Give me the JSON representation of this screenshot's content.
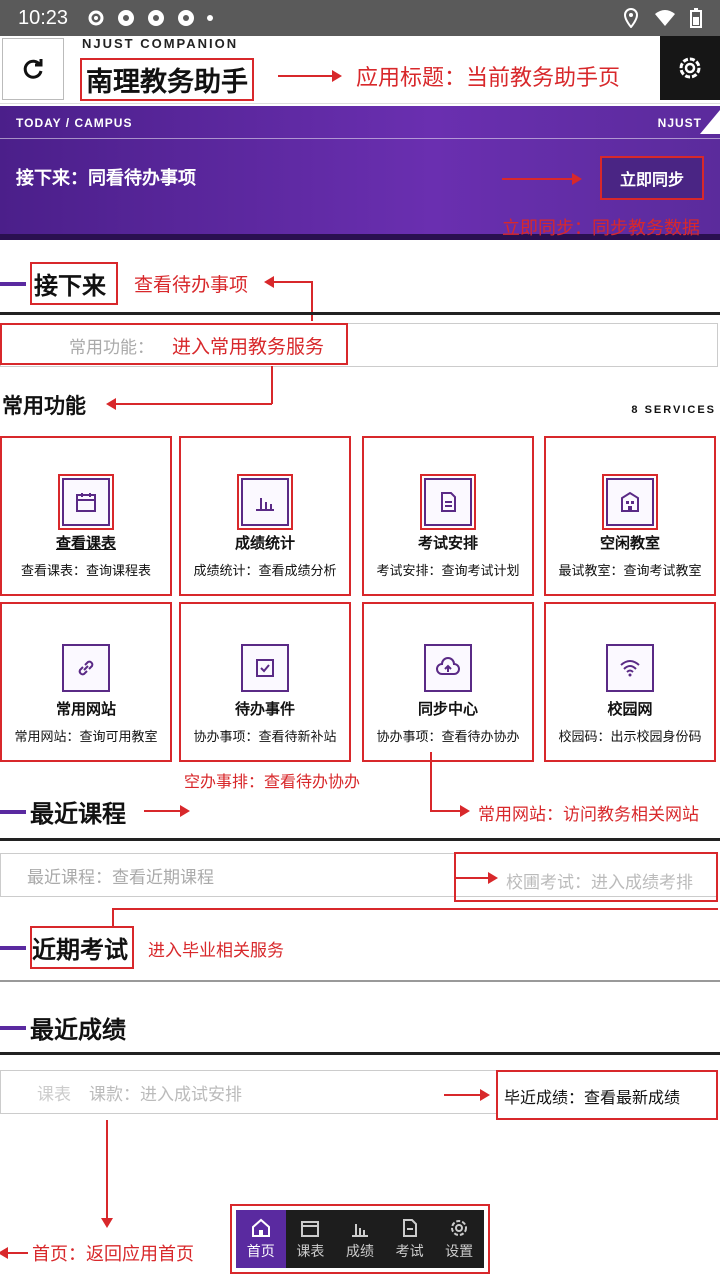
{
  "status": {
    "time": "10:23"
  },
  "header": {
    "subtitle": "NJUST COMPANION",
    "title": "南理教务助手"
  },
  "banner": {
    "top_left": "TODAY / CAMPUS",
    "top_right": "NJUST",
    "main_text": "接下来：同看待办事项",
    "sync_label": "立即同步"
  },
  "sections": {
    "next": "接下来",
    "services": "常用功能",
    "services_count": "8 SERVICES",
    "recent_courses": "最近课程",
    "upcoming_exams": "近期考试",
    "recent_grades": "最近成绩"
  },
  "faint_rows": {
    "services": "常用功能：",
    "courses": "最近课程：查看近期课程",
    "grades_a": "课表",
    "grades_b": "课款：进入成试安排"
  },
  "services": [
    {
      "name": "查看课表",
      "desc": "查看课表：查询课程表",
      "icon": "calendar-icon"
    },
    {
      "name": "成绩统计",
      "desc": "成绩统计：查看成绩分析",
      "icon": "bar-chart-icon"
    },
    {
      "name": "考试安排",
      "desc": "考试安排：查询考试计划",
      "icon": "document-icon"
    },
    {
      "name": "空闲教室",
      "desc": "最试教室：查询考试教室",
      "icon": "building-icon"
    },
    {
      "name": "常用网站",
      "desc": "常用网站：查询可用教室",
      "icon": "link-icon"
    },
    {
      "name": "待办事件",
      "desc": "协办事项：查看待新补站",
      "icon": "checkbox-icon"
    },
    {
      "name": "同步中心",
      "desc": "协办事项：查看待办协办",
      "icon": "cloud-upload-icon"
    },
    {
      "name": "校园网",
      "desc": "校园码：出示校园身份码",
      "icon": "wifi-icon"
    }
  ],
  "annotations": {
    "title": "应用标题：当前教务助手页",
    "sync": "立即同步：同步教务数据",
    "next": "查看待办事项",
    "services_row": "进入常用教务服务",
    "todo": "空办事排：查看待办协办",
    "websites": "常用网站：访问教务相关网站",
    "exams_box": "校圃考试：进入成绩考排",
    "graduation": "进入毕业相关服务",
    "grades": "毕近成绩：查看最新成绩",
    "home": "首页：返回应用首页"
  },
  "nav": [
    {
      "label": "首页",
      "icon": "home-icon",
      "active": true
    },
    {
      "label": "课表",
      "icon": "calendar-icon",
      "active": false
    },
    {
      "label": "成绩",
      "icon": "bar-chart-icon",
      "active": false
    },
    {
      "label": "考试",
      "icon": "document-icon",
      "active": false
    },
    {
      "label": "设置",
      "icon": "gear-icon",
      "active": false
    }
  ],
  "colors": {
    "accent": "#5a2aa0",
    "annotation": "#d8282b"
  }
}
